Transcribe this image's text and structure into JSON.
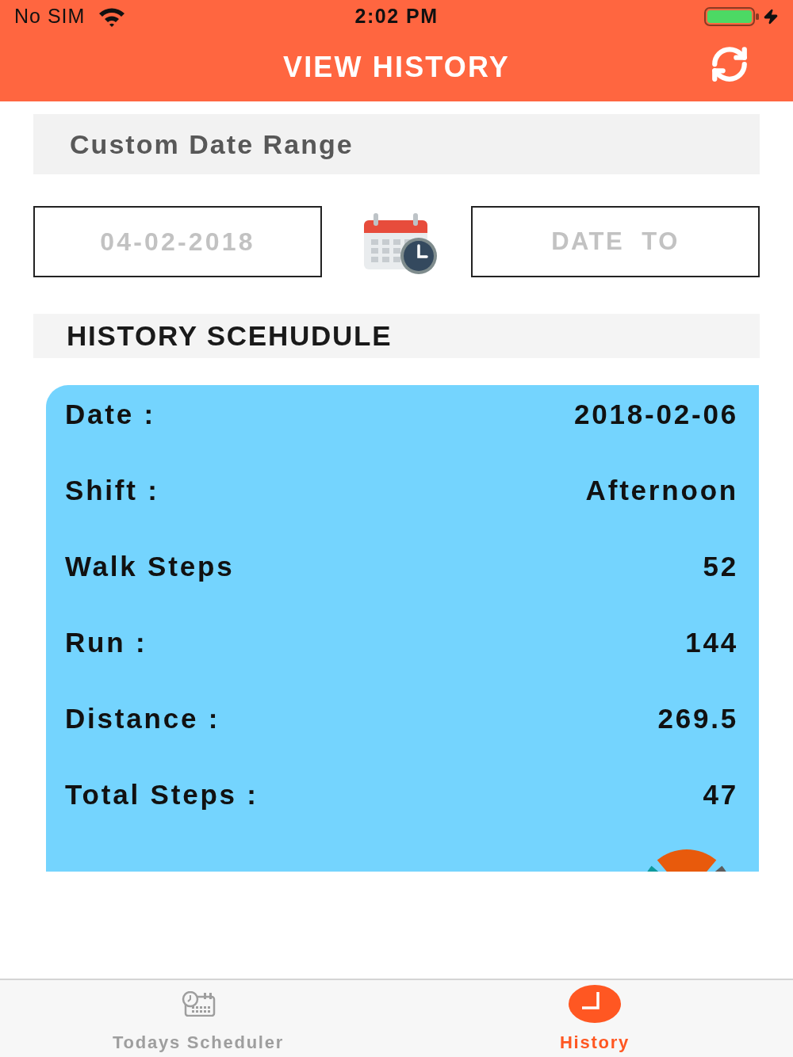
{
  "status_bar": {
    "carrier": "No SIM",
    "time": "2:02 PM"
  },
  "header": {
    "title": "VIEW HISTORY"
  },
  "date_range": {
    "title": "Custom Date Range",
    "from_field": {
      "placeholder": "04-02-2018"
    },
    "to_field": {
      "placeholder": "DATE  TO"
    }
  },
  "schedule": {
    "title": "HISTORY SCEHUDULE",
    "rows": [
      {
        "label": "Date :",
        "value": "2018-02-06"
      },
      {
        "label": "Shift :",
        "value": "Afternoon"
      },
      {
        "label": "Walk Steps",
        "value": "52"
      },
      {
        "label": "Run :",
        "value": "144"
      },
      {
        "label": "Distance :",
        "value": "269.5"
      },
      {
        "label": "Total Steps :",
        "value": "47"
      }
    ]
  },
  "tab_bar": {
    "tabs": [
      {
        "label": "Todays Scheduler",
        "selected": false
      },
      {
        "label": "History",
        "selected": true
      }
    ]
  }
}
